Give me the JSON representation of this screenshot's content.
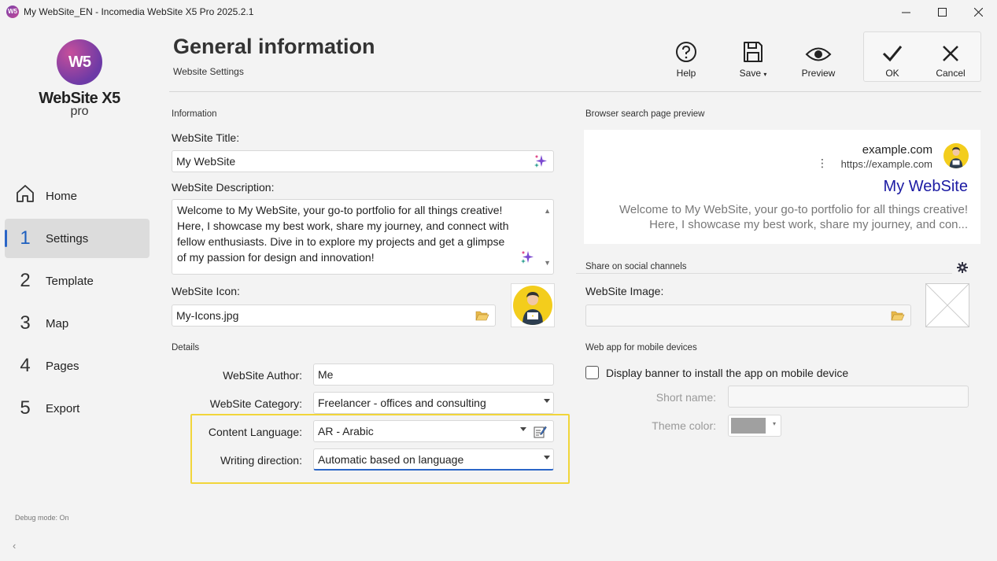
{
  "window": {
    "icon_text": "W5",
    "title": "My WebSite_EN - Incomedia WebSite X5 Pro 2025.2.1"
  },
  "logo": {
    "mark": "W5",
    "name": "WebSite X5",
    "edition": "pro"
  },
  "nav": [
    {
      "num": "",
      "label": "Home",
      "icon": "home-icon"
    },
    {
      "num": "1",
      "label": "Settings",
      "active": true
    },
    {
      "num": "2",
      "label": "Template"
    },
    {
      "num": "3",
      "label": "Map"
    },
    {
      "num": "4",
      "label": "Pages"
    },
    {
      "num": "5",
      "label": "Export"
    }
  ],
  "debug": "Debug mode: On",
  "header": {
    "title": "General information",
    "subtitle": "Website Settings"
  },
  "toolbar": {
    "help": "Help",
    "save": "Save",
    "preview": "Preview",
    "ok": "OK",
    "cancel": "Cancel"
  },
  "info": {
    "section": "Information",
    "title_label": "WebSite Title:",
    "title_value": "My WebSite",
    "desc_label": "WebSite Description:",
    "desc_lines": [
      "Welcome to My WebSite, your go-to portfolio for all things creative!",
      "Here, I showcase my best work, share my journey, and connect with",
      "fellow enthusiasts. Dive in to explore my projects and get a glimpse",
      "of my passion for design and innovation!"
    ],
    "icon_label": "WebSite Icon:",
    "icon_value": "My-Icons.jpg"
  },
  "details": {
    "section": "Details",
    "author_label": "WebSite Author:",
    "author_value": "Me",
    "category_label": "WebSite Category:",
    "category_value": "Freelancer - offices and consulting",
    "language_label": "Content Language:",
    "language_value": "AR - Arabic",
    "direction_label": "Writing direction:",
    "direction_value": "Automatic based on language"
  },
  "preview": {
    "section": "Browser search page preview",
    "domain": "example.com",
    "url": "https://example.com",
    "title": "My WebSite",
    "desc_line1": "Welcome to My WebSite, your go-to portfolio for all things creative!",
    "desc_line2": "Here, I showcase my best work, share my journey, and con..."
  },
  "social": {
    "section": "Share on social channels",
    "image_label": "WebSite Image:",
    "image_value": ""
  },
  "webapp": {
    "section": "Web app for mobile devices",
    "banner_label": "Display banner to install the app on mobile device",
    "short_name_label": "Short name:",
    "short_name_value": "",
    "theme_color_label": "Theme color:",
    "theme_color": "#a0a0a0"
  },
  "colors": {
    "accent": "#2b66c7",
    "highlight": "#f1d53a",
    "link_title": "#1b1aa3"
  }
}
